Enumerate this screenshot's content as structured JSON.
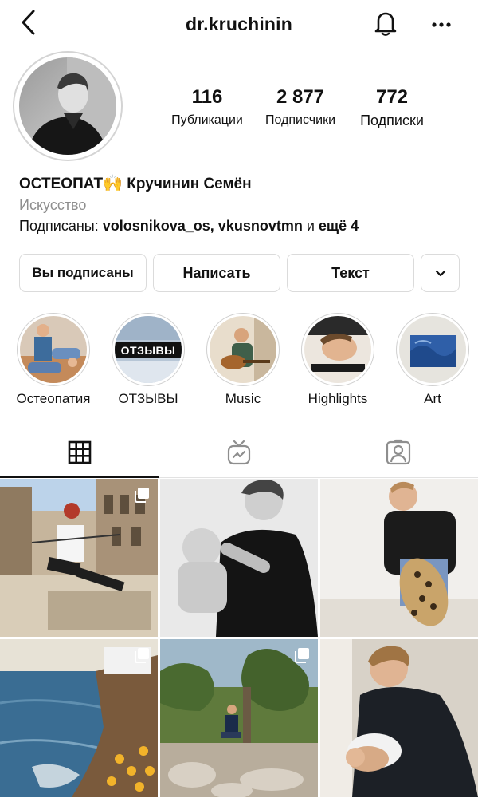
{
  "header": {
    "username": "dr.kruchinin",
    "back_icon": "chevron-left-icon",
    "bell_icon": "bell-icon",
    "more_icon": "more-horizontal-icon"
  },
  "profile": {
    "stats": [
      {
        "value": "116",
        "label": "Публикации"
      },
      {
        "value": "2 877",
        "label": "Подписчики"
      },
      {
        "value": "772",
        "label": "Подписки"
      }
    ],
    "name_prefix": "ОСТЕОПАТ",
    "name_emoji": "🙌",
    "name_suffix": " Кручинин Семён",
    "category": "Искусство",
    "followed_by_prefix": "Подписаны: ",
    "followed_by_names": "volosnikova_os, vkusnovtmn",
    "followed_by_and": " и ",
    "followed_by_more": "ещё 4"
  },
  "actions": {
    "following": "Вы подписаны",
    "message": "Написать",
    "text": "Текст",
    "more_icon": "chevron-down-icon"
  },
  "highlights": [
    {
      "label": "Остеопатия"
    },
    {
      "label": "ОТЗЫВЫ",
      "overlay_text": "ОТЗЫВЫ"
    },
    {
      "label": "Music"
    },
    {
      "label": "Highlights"
    },
    {
      "label": "Art"
    }
  ],
  "tabs": [
    {
      "name": "grid",
      "icon": "grid-icon",
      "active": true
    },
    {
      "name": "igtv",
      "icon": "igtv-icon",
      "active": false
    },
    {
      "name": "tagged",
      "icon": "tagged-user-icon",
      "active": false
    }
  ],
  "posts": [
    {
      "multi": true
    },
    {
      "multi": false
    },
    {
      "multi": false
    },
    {
      "multi": true
    },
    {
      "multi": true
    },
    {
      "multi": false
    }
  ]
}
